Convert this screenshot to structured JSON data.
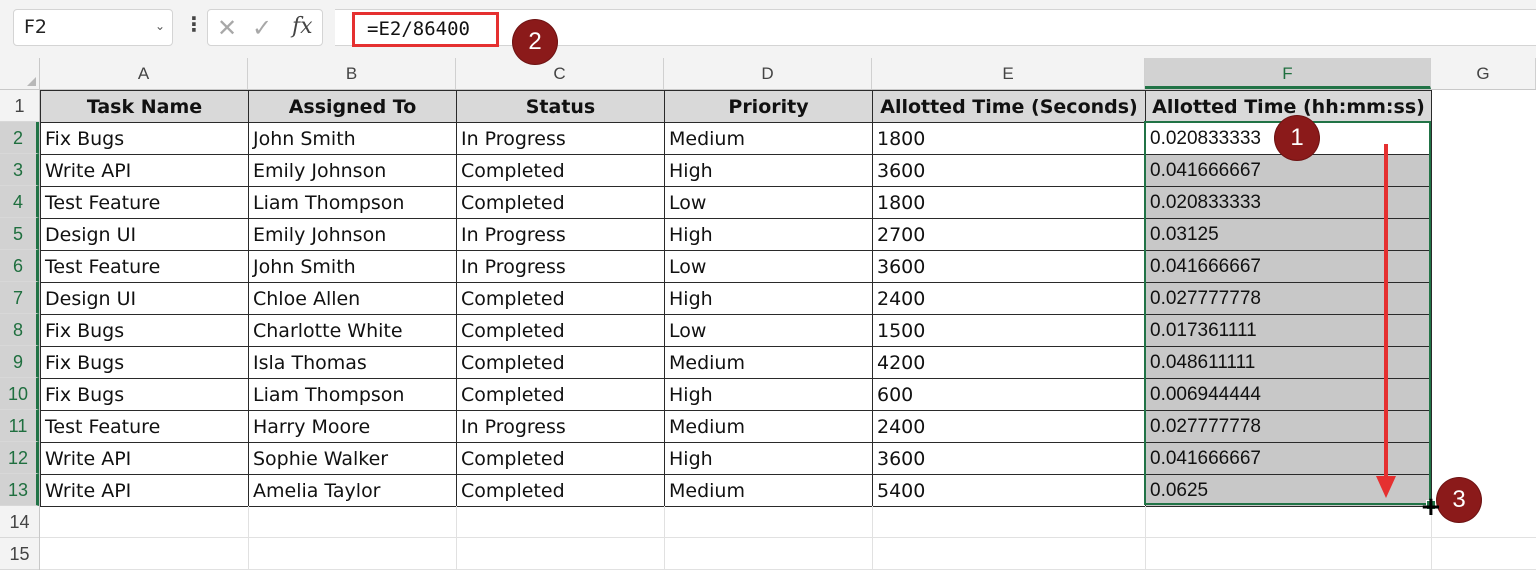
{
  "formula_bar": {
    "name_box": "F2",
    "name_box_arrow": "⌄",
    "more_icon": "⋮",
    "cancel_icon": "✕",
    "enter_icon": "✓",
    "fx_label": "fx",
    "formula": "=E2/86400"
  },
  "columns": [
    "A",
    "B",
    "C",
    "D",
    "E",
    "F",
    "G"
  ],
  "rows": [
    "1",
    "2",
    "3",
    "4",
    "5",
    "6",
    "7",
    "8",
    "9",
    "10",
    "11",
    "12",
    "13",
    "14",
    "15"
  ],
  "table": {
    "headers": [
      "Task Name",
      "Assigned To",
      "Status",
      "Priority",
      "Allotted Time (Seconds)",
      "Allotted Time (hh:mm:ss)"
    ],
    "data": [
      [
        "Fix Bugs",
        "John Smith",
        "In Progress",
        "Medium",
        "1800",
        "0.020833333"
      ],
      [
        "Write API",
        "Emily Johnson",
        "Completed",
        "High",
        "3600",
        "0.041666667"
      ],
      [
        "Test Feature",
        "Liam Thompson",
        "Completed",
        "Low",
        "1800",
        "0.020833333"
      ],
      [
        "Design UI",
        "Emily Johnson",
        "In Progress",
        "High",
        "2700",
        "0.03125"
      ],
      [
        "Test Feature",
        "John Smith",
        "In Progress",
        "Low",
        "3600",
        "0.041666667"
      ],
      [
        "Design UI",
        "Chloe Allen",
        "Completed",
        "High",
        "2400",
        "0.027777778"
      ],
      [
        "Fix Bugs",
        "Charlotte White",
        "Completed",
        "Low",
        "1500",
        "0.017361111"
      ],
      [
        "Fix Bugs",
        "Isla Thomas",
        "Completed",
        "Medium",
        "4200",
        "0.048611111"
      ],
      [
        "Fix Bugs",
        "Liam Thompson",
        "Completed",
        "High",
        "600",
        "0.006944444"
      ],
      [
        "Test Feature",
        "Harry Moore",
        "In Progress",
        "Medium",
        "2400",
        "0.027777778"
      ],
      [
        "Write API",
        "Sophie Walker",
        "Completed",
        "High",
        "3600",
        "0.041666667"
      ],
      [
        "Write API",
        "Amelia Taylor",
        "Completed",
        "Medium",
        "5400",
        "0.0625"
      ]
    ]
  },
  "annotations": {
    "badge1": "1",
    "badge2": "2",
    "badge3": "3",
    "fill_cursor": "+"
  },
  "colors": {
    "selection": "#217346",
    "annotation_red": "#e53030",
    "badge": "#8b1a1a",
    "header_fill": "#d9d9d9"
  }
}
